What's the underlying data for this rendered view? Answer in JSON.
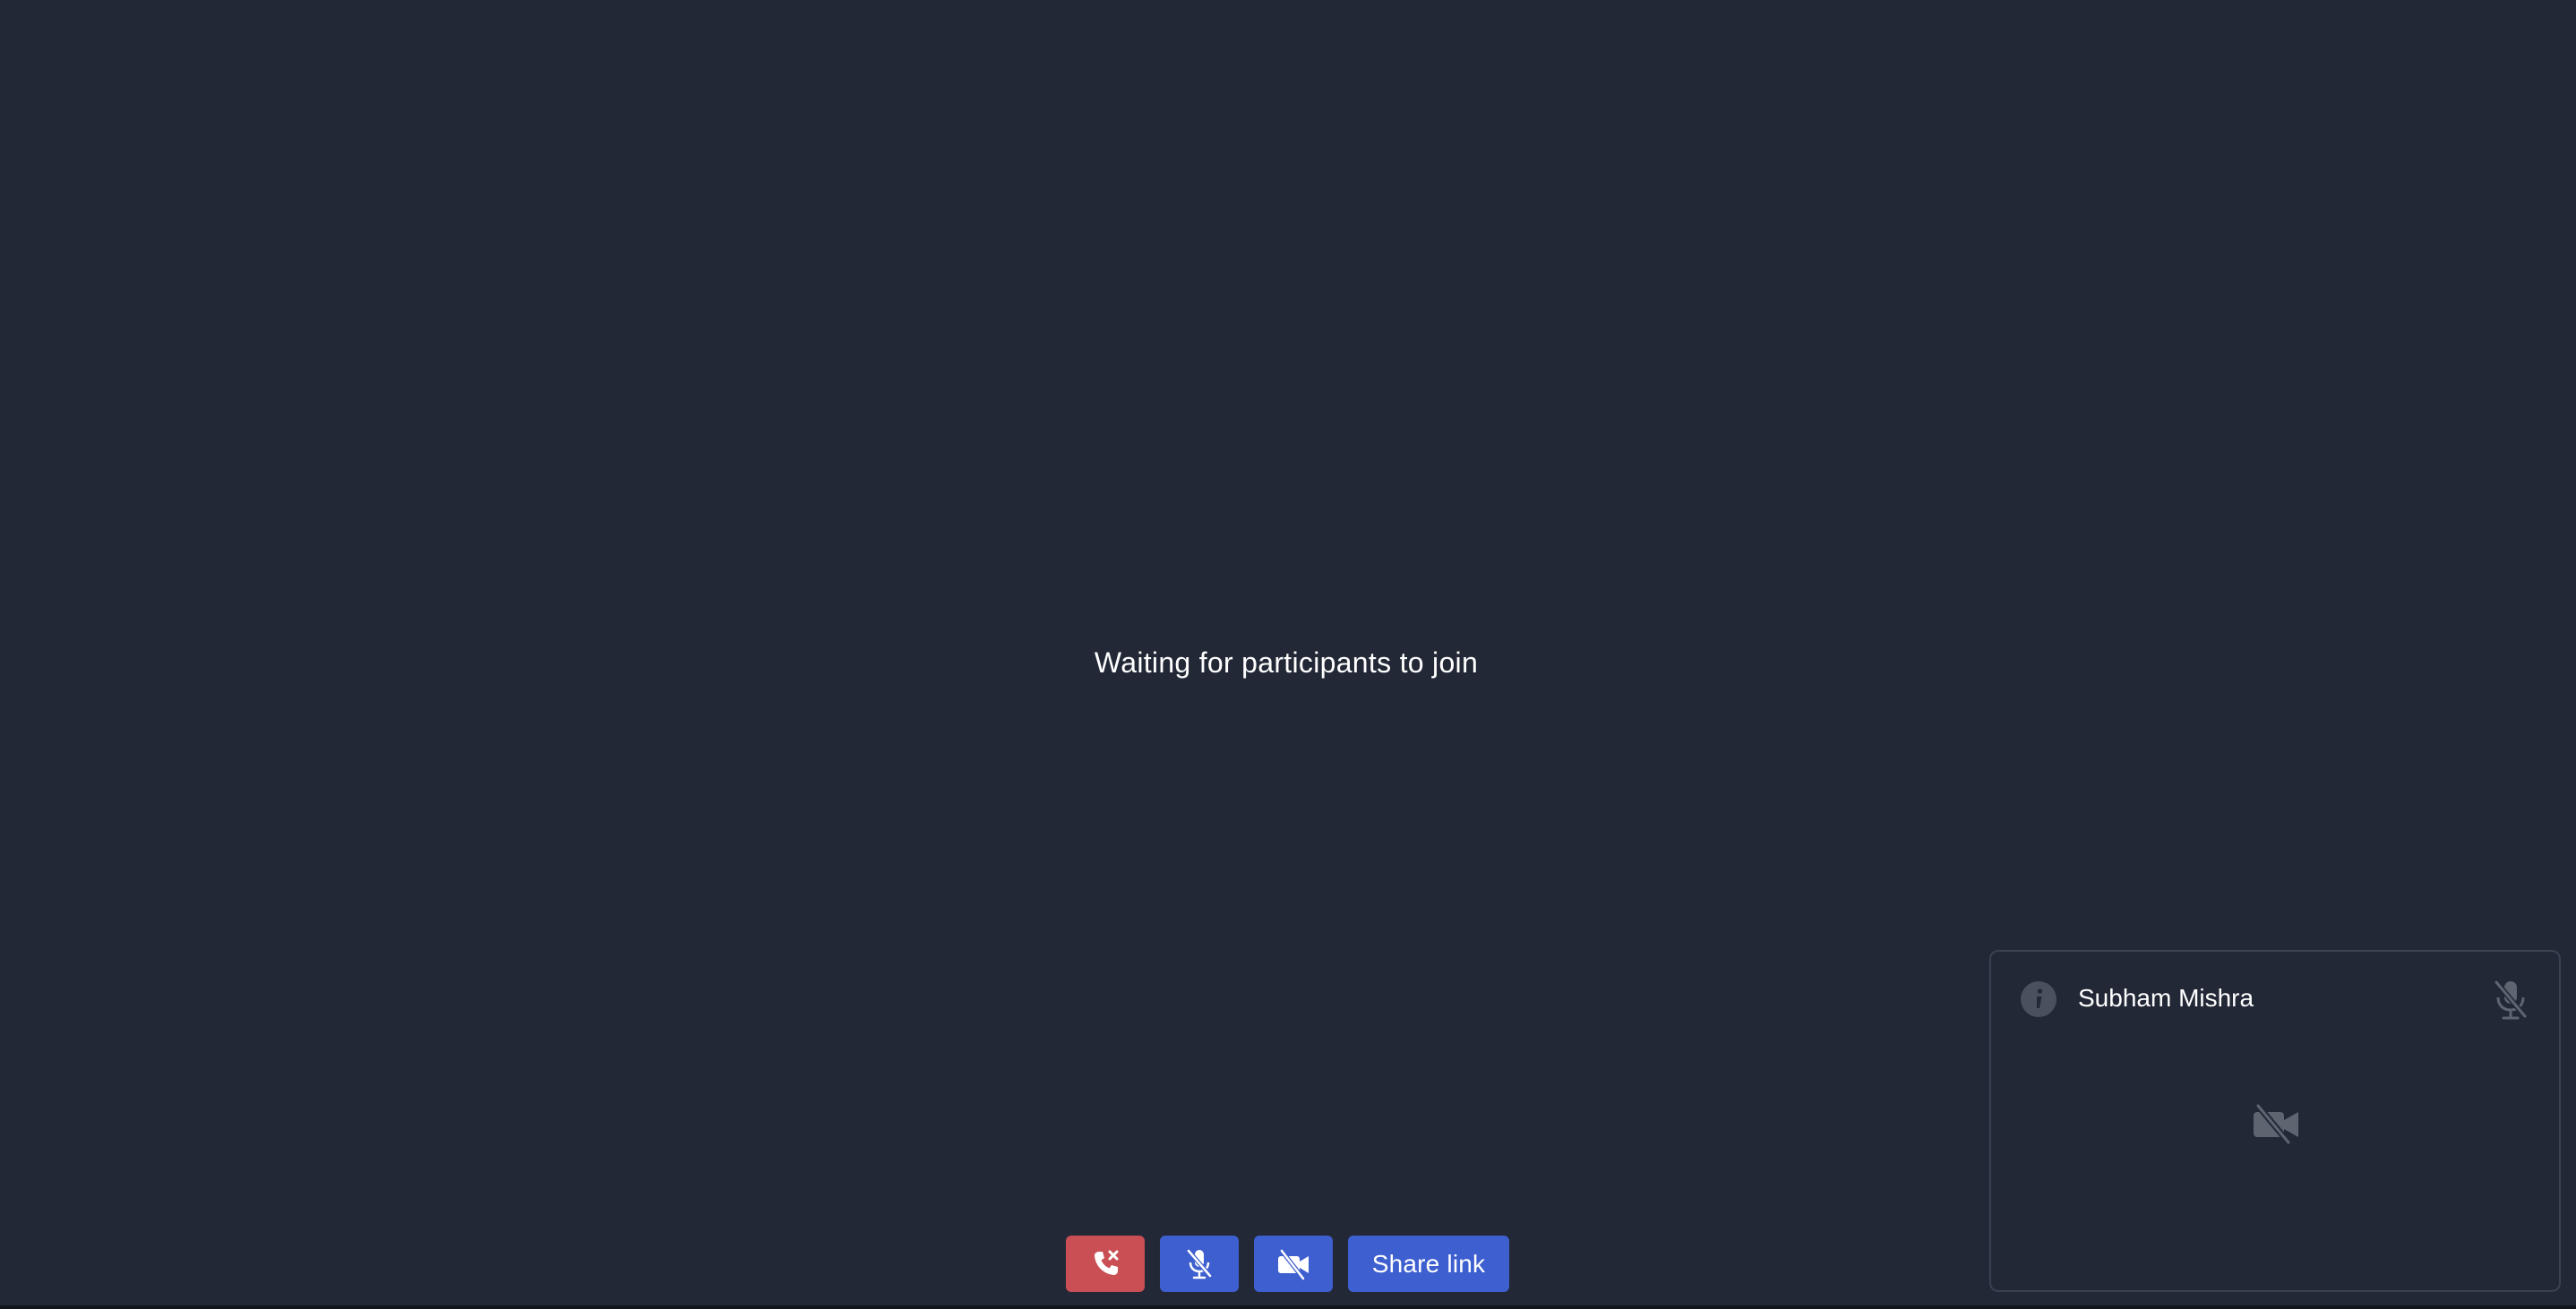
{
  "main": {
    "waiting_text": "Waiting for participants to join"
  },
  "controls": {
    "hangup_icon": "phone-hangup-icon",
    "mic_icon": "mic-off-icon",
    "camera_icon": "camera-off-icon",
    "share_label": "Share link"
  },
  "participant": {
    "name": "Subham Mishra",
    "info_icon": "info-icon",
    "mic_icon": "mic-off-icon",
    "camera_icon": "camera-off-icon"
  },
  "colors": {
    "background": "#222836",
    "hangup": "#c94f55",
    "accent": "#3e5fcf",
    "tile_border": "#3a4152",
    "muted_icon": "#5e6470"
  }
}
